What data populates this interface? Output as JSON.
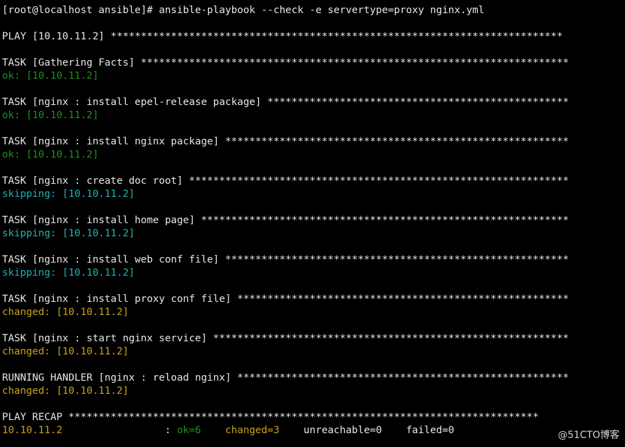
{
  "prompt_command": "[root@localhost ansible]# ansible-playbook --check -e servertype=proxy nginx.yml",
  "play_header": "PLAY [10.10.11.2] ***************************************************************************",
  "tasks": [
    {
      "header": "TASK [Gathering Facts] ***********************************************************************",
      "result": "ok: [10.10.11.2]"
    },
    {
      "header": "TASK [nginx : install epel-release package] **************************************************",
      "result": "ok: [10.10.11.2]"
    },
    {
      "header": "TASK [nginx : install nginx package] *********************************************************",
      "result": "ok: [10.10.11.2]"
    },
    {
      "header": "TASK [nginx : create doc root] ***************************************************************",
      "result": "skipping: [10.10.11.2]"
    },
    {
      "header": "TASK [nginx : install home page] *************************************************************",
      "result": "skipping: [10.10.11.2]"
    },
    {
      "header": "TASK [nginx : install web conf file] *********************************************************",
      "result": "skipping: [10.10.11.2]"
    },
    {
      "header": "TASK [nginx : install proxy conf file] *******************************************************",
      "result": "changed: [10.10.11.2]"
    },
    {
      "header": "TASK [nginx : start nginx service] ***********************************************************",
      "result": "changed: [10.10.11.2]"
    },
    {
      "header": "RUNNING HANDLER [nginx : reload nginx] *******************************************************",
      "result": "changed: [10.10.11.2]"
    }
  ],
  "recap_header": "PLAY RECAP ******************************************************************************",
  "recap": {
    "host": "10.10.11.2",
    "sep": "                 : ",
    "ok": "ok=6",
    "changed": "changed=3",
    "unreachable": "unreachable=0",
    "failed": "failed=0"
  },
  "watermark": "@51CTO博客",
  "colors": {
    "background": "#000000",
    "text": "#e8e8e8",
    "ok": "#1f8f1f",
    "skipping": "#20b2b2",
    "changed": "#c8a418"
  }
}
